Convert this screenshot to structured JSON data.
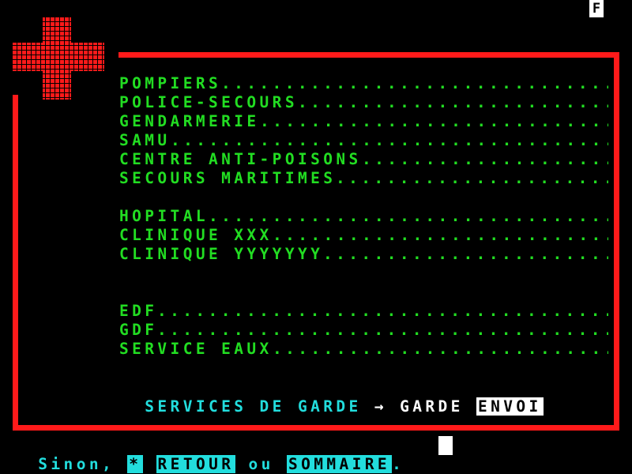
{
  "page": {
    "mode_badge": "F"
  },
  "emergency": [
    {
      "label": "POMPIERS"
    },
    {
      "label": "POLICE-SECOURS"
    },
    {
      "label": "GENDARMERIE"
    },
    {
      "label": "SAMU"
    },
    {
      "label": "CENTRE ANTI-POISONS"
    },
    {
      "label": "SECOURS MARITIMES"
    }
  ],
  "hospitals": [
    {
      "label": "HOPITAL"
    },
    {
      "label": "CLINIQUE XXX"
    },
    {
      "label": "CLINIQUE YYYYYYY"
    }
  ],
  "utilities": [
    {
      "label": "EDF"
    },
    {
      "label": "GDF"
    },
    {
      "label": "SERVICE EAUX"
    }
  ],
  "services": {
    "label": "SERVICES DE GARDE",
    "arrow": "→",
    "keyword": "GARDE",
    "send_key": "ENVOI"
  },
  "footer": {
    "prefix": "Sinon,",
    "star_key": "*",
    "retour_key": "RETOUR",
    "or_word": "ou",
    "sommaire_key": "SOMMAIRE",
    "end": "."
  },
  "colors": {
    "frame": "#ff1a1a",
    "text_primary": "#22dd22",
    "text_secondary": "#22dddd",
    "background": "#000000"
  },
  "icons": {
    "cross": "red-cross-icon"
  }
}
